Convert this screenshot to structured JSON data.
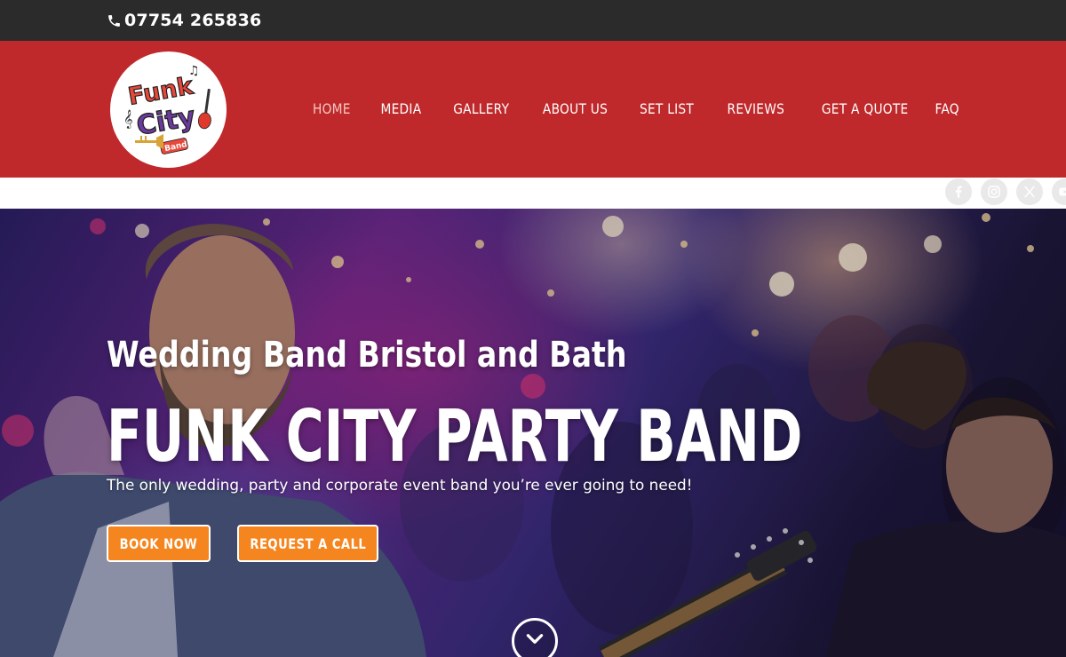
{
  "topbar": {
    "phone": "07754 265836",
    "phone_icon": "phone-icon"
  },
  "header": {
    "logo": {
      "line1": "Funk",
      "line2": "City",
      "line3": "Band"
    },
    "nav": [
      {
        "label": "HOME",
        "active": true
      },
      {
        "label": "MEDIA"
      },
      {
        "label": "GALLERY"
      },
      {
        "label": "ABOUT US"
      },
      {
        "label": "SET LIST"
      },
      {
        "label": "REVIEWS"
      },
      {
        "label": "GET A QUOTE"
      },
      {
        "label": "FAQ"
      }
    ]
  },
  "social": [
    "facebook-icon",
    "instagram-icon",
    "x-icon",
    "youtube-icon"
  ],
  "hero": {
    "subtitle": "Wedding Band Bristol and Bath",
    "title": "FUNK CITY PARTY BAND",
    "tagline": "The only wedding, party and corporate event band you’re ever going to need!",
    "buttons": {
      "book": "BOOK NOW",
      "call": "REQUEST A CALL"
    },
    "scroll_icon": "chevron-down-icon"
  },
  "colors": {
    "topbar": "#2b2b2b",
    "header": "#c0292b",
    "nav_active": "#f3c7c0",
    "button": "#f5861f"
  }
}
